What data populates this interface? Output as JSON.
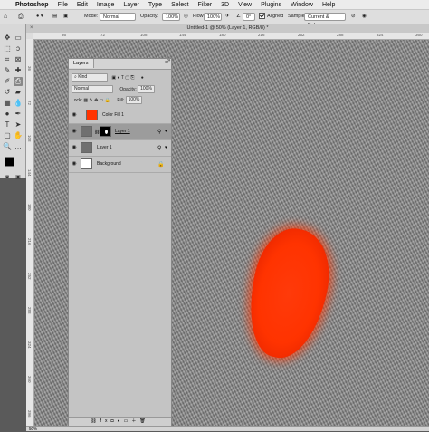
{
  "menubar": {
    "items": [
      "Photoshop",
      "File",
      "Edit",
      "Image",
      "Layer",
      "Type",
      "Select",
      "Filter",
      "3D",
      "View",
      "Plugins",
      "Window",
      "Help"
    ]
  },
  "options": {
    "mode_label": "Mode:",
    "mode_value": "Normal",
    "opacity_label": "Opacity:",
    "opacity_value": "100%",
    "flow_label": "Flow:",
    "flow_value": "100%",
    "angle_value": "0°",
    "aligned_label": "Aligned",
    "sample_label": "Sample:",
    "sample_value": "Current & Below"
  },
  "document": {
    "tab_title": "Untitled-1 @ 50% (Layer 1, RGB/8) *",
    "hruler_ticks": [
      "36",
      "72",
      "108",
      "144",
      "180",
      "216",
      "252",
      "288",
      "324",
      "360"
    ],
    "vruler_ticks": [
      "36",
      "72",
      "108",
      "144",
      "180",
      "216",
      "252",
      "288",
      "324",
      "360",
      "396"
    ],
    "zoom": "50%"
  },
  "layers_panel": {
    "title": "Layers",
    "kind_label": "Kind",
    "blend_mode": "Normal",
    "opacity_label": "Opacity:",
    "opacity_value": "100%",
    "lock_label": "Lock:",
    "fill_label": "Fill:",
    "fill_value": "100%",
    "layers": [
      {
        "name": "Color Fill 1",
        "thumb_color": "#ff3300",
        "selected": false
      },
      {
        "name": "Layer 1",
        "thumb_color": "#707070",
        "selected": true,
        "has_mask": true
      },
      {
        "name": "Layer 1",
        "thumb_color": "#707070",
        "selected": false
      },
      {
        "name": "Background",
        "thumb_color": "#ffffff",
        "selected": false,
        "locked": true
      }
    ]
  },
  "colors": {
    "accent_fill": "#ff3300",
    "foreground": "#000000",
    "background": "#ffffff"
  }
}
